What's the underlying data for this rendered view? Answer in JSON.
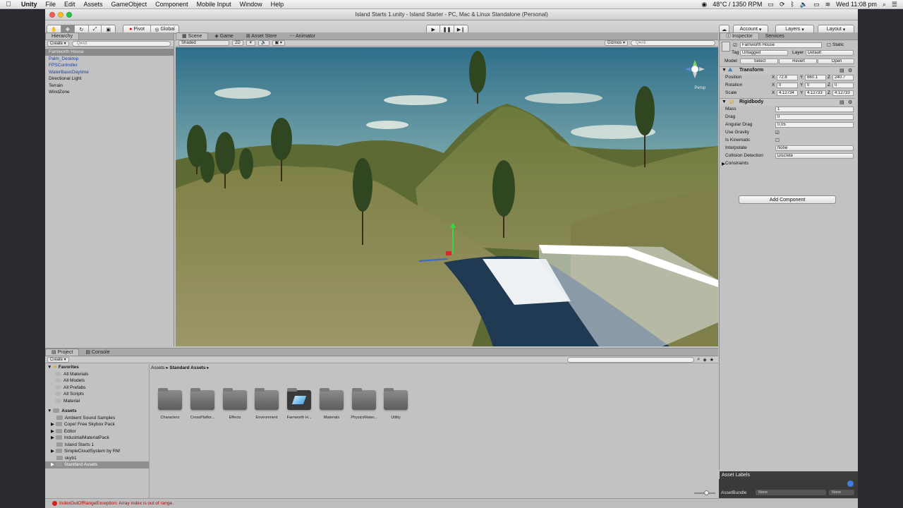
{
  "menubar": {
    "app": "Unity",
    "items": [
      "File",
      "Edit",
      "Assets",
      "GameObject",
      "Component",
      "Mobile Input",
      "Window",
      "Help"
    ],
    "status": "48°C / 1350 RPM",
    "clock": "Wed 11:08 pm"
  },
  "window": {
    "title": "Island Starts 1.unity - Island Starter - PC, Mac & Linux Standalone (Personal)"
  },
  "toolbar": {
    "pivot": "Pivot",
    "global": "Global",
    "account": "Account",
    "layers": "Layers",
    "layout": "Layout"
  },
  "hierarchy": {
    "tab": "Hierarchy",
    "create": "Create",
    "search_placeholder": "Q▾All",
    "items": [
      "Farnworth House",
      "Palm_Desktop",
      "FPSController",
      "WaterBasicDaytime",
      "Directional Light",
      "Terrain",
      "WindZone"
    ]
  },
  "scene": {
    "tabs": [
      "Scene",
      "Game",
      "Asset Store",
      "Animator"
    ],
    "shading": "Shaded",
    "mode2d": "2D",
    "gizmos": "Gizmos",
    "search_placeholder": "Q▾All",
    "persp": "Persp"
  },
  "inspector": {
    "tabs": [
      "Inspector",
      "Services"
    ],
    "object_name": "Farnworth House",
    "static_label": "Static",
    "tag_label": "Tag",
    "tag_value": "Untagged",
    "layer_label": "Layer",
    "layer_value": "Default",
    "model_label": "Model",
    "model_buttons": [
      "Select",
      "Revert",
      "Open"
    ],
    "transform": {
      "title": "Transform",
      "position_label": "Position",
      "rotation_label": "Rotation",
      "scale_label": "Scale",
      "position": {
        "x": "72.8",
        "y": "860.1",
        "z": "240.7"
      },
      "rotation": {
        "x": "0",
        "y": "0",
        "z": "0"
      },
      "scale": {
        "x": "4.12734",
        "y": "4.12733",
        "z": "4.12733"
      }
    },
    "rigidbody": {
      "title": "Rigidbody",
      "mass_label": "Mass",
      "mass": "1",
      "drag_label": "Drag",
      "drag": "0",
      "angular_drag_label": "Angular Drag",
      "angular_drag": "0.05",
      "use_gravity_label": "Use Gravity",
      "is_kinematic_label": "Is Kinematic",
      "interpolate_label": "Interpolate",
      "interpolate": "None",
      "collision_label": "Collision Detection",
      "collision": "Discrete",
      "constraints_label": "Constraints"
    },
    "add_component": "Add Component",
    "asset_labels": "Asset Labels",
    "asset_bundle": "AssetBundle",
    "asset_bundle_value": "None",
    "asset_bundle_variant": "None"
  },
  "project": {
    "tabs": [
      "Project",
      "Console"
    ],
    "create": "Create",
    "favorites_label": "Favorites",
    "favorites": [
      "All Materials",
      "All Models",
      "All Prefabs",
      "All Scripts",
      "Material"
    ],
    "assets_label": "Assets",
    "assets": [
      "Ambient Sound Samples",
      "Cope! Free Skybox Pack",
      "Editor",
      "IndustrialMaterialPack",
      "Island Starts 1",
      "SimpleCloudSystem by RM",
      "skyb1",
      "Standard Assets"
    ],
    "breadcrumb": [
      "Assets",
      "Standard Assets"
    ],
    "grid": [
      "Characters",
      "CrossPlatfor...",
      "Effects",
      "Environment",
      "Farnworth H...",
      "Materials",
      "PhysicsMater...",
      "Utility"
    ]
  },
  "status": {
    "error": "IndexOutOfRangeException: Array index is out of range."
  }
}
